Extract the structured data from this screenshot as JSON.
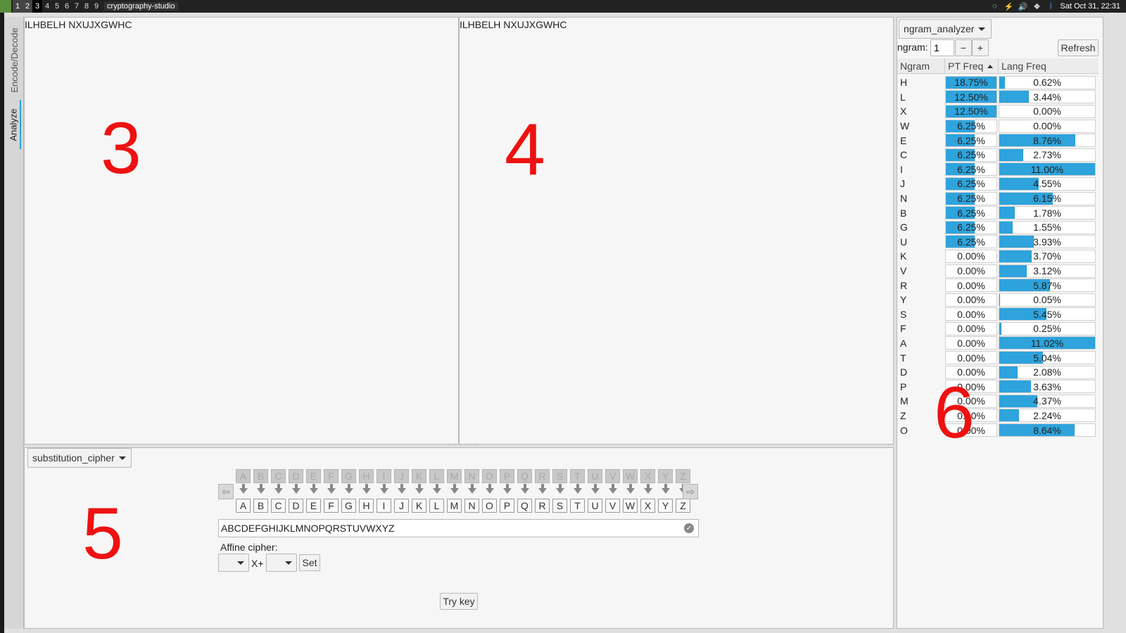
{
  "topbar": {
    "workspaces": [
      "1",
      "2",
      "3",
      "4",
      "5",
      "6",
      "7",
      "8",
      "9"
    ],
    "active_workspace": "3",
    "app_name": "cryptography-studio",
    "datetime": "Sat Oct 31, 22:31"
  },
  "tabs": {
    "encode": "Encode/Decode",
    "analyze": "Analyze"
  },
  "panes": {
    "ciphertext": "ILHBELH NXUJXGWHC",
    "plaintext": "ILHBELH NXUJXGWHC",
    "label3": "3",
    "label4": "4",
    "label5": "5",
    "label6": "6"
  },
  "cipher": {
    "selector": "substitution_cipher",
    "alphabet": [
      "A",
      "B",
      "C",
      "D",
      "E",
      "F",
      "G",
      "H",
      "I",
      "J",
      "K",
      "L",
      "M",
      "N",
      "O",
      "P",
      "Q",
      "R",
      "S",
      "T",
      "U",
      "V",
      "W",
      "X",
      "Y",
      "Z"
    ],
    "key": "ABCDEFGHIJKLMNOPQRSTUVWXYZ",
    "affine_label": "Affine cipher:",
    "affine_x": "X+",
    "set_label": "Set",
    "try_key_label": "Try key"
  },
  "analyzer": {
    "selector": "ngram_analyzer",
    "ngram_label": "ngram:",
    "ngram_value": "1",
    "minus": "−",
    "plus": "+",
    "refresh_label": "Refresh",
    "columns": [
      "Ngram",
      "PT Freq",
      "Lang Freq"
    ],
    "rows": [
      {
        "ngram": "H",
        "pt": "18.75%",
        "lang": "0.62%"
      },
      {
        "ngram": "L",
        "pt": "12.50%",
        "lang": "3.44%"
      },
      {
        "ngram": "X",
        "pt": "12.50%",
        "lang": "0.00%"
      },
      {
        "ngram": "W",
        "pt": "6.25%",
        "lang": "0.00%"
      },
      {
        "ngram": "E",
        "pt": "6.25%",
        "lang": "8.76%"
      },
      {
        "ngram": "C",
        "pt": "6.25%",
        "lang": "2.73%"
      },
      {
        "ngram": "I",
        "pt": "6.25%",
        "lang": "11.00%"
      },
      {
        "ngram": "J",
        "pt": "6.25%",
        "lang": "4.55%"
      },
      {
        "ngram": "N",
        "pt": "6.25%",
        "lang": "6.15%"
      },
      {
        "ngram": "B",
        "pt": "6.25%",
        "lang": "1.78%"
      },
      {
        "ngram": "G",
        "pt": "6.25%",
        "lang": "1.55%"
      },
      {
        "ngram": "U",
        "pt": "6.25%",
        "lang": "3.93%"
      },
      {
        "ngram": "K",
        "pt": "0.00%",
        "lang": "3.70%"
      },
      {
        "ngram": "V",
        "pt": "0.00%",
        "lang": "3.12%"
      },
      {
        "ngram": "R",
        "pt": "0.00%",
        "lang": "5.87%"
      },
      {
        "ngram": "Y",
        "pt": "0.00%",
        "lang": "0.05%"
      },
      {
        "ngram": "S",
        "pt": "0.00%",
        "lang": "5.45%"
      },
      {
        "ngram": "F",
        "pt": "0.00%",
        "lang": "0.25%"
      },
      {
        "ngram": "A",
        "pt": "0.00%",
        "lang": "11.02%"
      },
      {
        "ngram": "T",
        "pt": "0.00%",
        "lang": "5.04%"
      },
      {
        "ngram": "D",
        "pt": "0.00%",
        "lang": "2.08%"
      },
      {
        "ngram": "P",
        "pt": "0.00%",
        "lang": "3.63%"
      },
      {
        "ngram": "M",
        "pt": "0.00%",
        "lang": "4.37%"
      },
      {
        "ngram": "Z",
        "pt": "0.00%",
        "lang": "2.24%"
      },
      {
        "ngram": "O",
        "pt": "0.00%",
        "lang": "8.64%"
      }
    ]
  },
  "colors": {
    "accent": "#2ea3dc",
    "annotation": "#ee1111"
  }
}
